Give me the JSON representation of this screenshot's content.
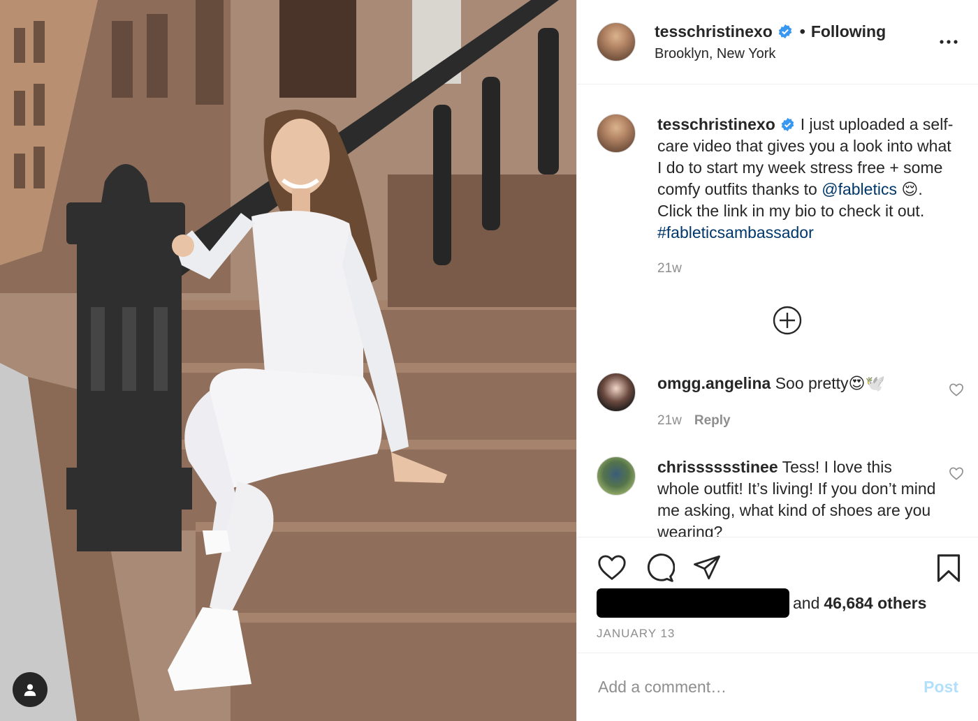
{
  "header": {
    "username": "tesschristinexo",
    "separator": "•",
    "follow_status": "Following",
    "location": "Brooklyn, New York"
  },
  "caption": {
    "username": "tesschristinexo",
    "text_1": "I just uploaded a self-care video that gives you a look into what I do to start my week stress free + some comfy outfits thanks to ",
    "mention": "@fabletics",
    "emoji": "😌",
    "text_2": ". Click the link in my bio to check it out. ",
    "hashtag": "#fableticsambassador",
    "time": "21w"
  },
  "comments": [
    {
      "username": "omgg.angelina",
      "text": "Soo pretty😍🕊️",
      "time": "21w",
      "reply_label": "Reply"
    },
    {
      "username": "chrisssssstinee",
      "text": "Tess! I love this whole outfit! It’s living! If you don’t mind me asking, what kind of shoes are you wearing?"
    }
  ],
  "likes": {
    "prefix": "and",
    "count_text": "46,684 others"
  },
  "post_date": "JANUARY 13",
  "add_comment": {
    "placeholder": "Add a comment…",
    "post_label": "Post"
  },
  "colors": {
    "verified": "#3897f0",
    "link": "#00376b",
    "muted": "#8e8e8e",
    "post_button_disabled": "#b2dffc"
  },
  "icons": [
    "verified-badge-icon",
    "more-options-icon",
    "load-more-comments-icon",
    "heart-icon",
    "comment-icon",
    "share-icon",
    "bookmark-icon",
    "user-tag-icon"
  ]
}
